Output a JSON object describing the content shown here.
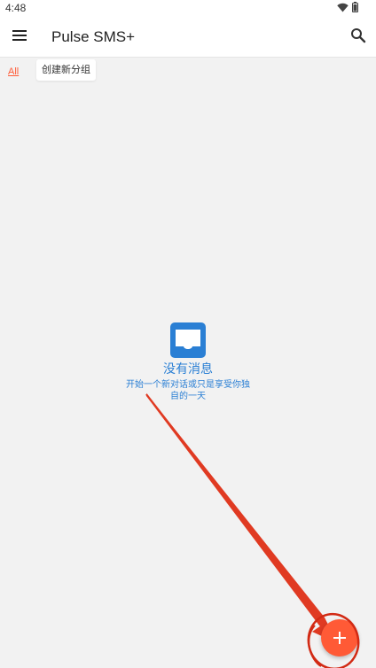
{
  "status_bar": {
    "time": "4:48",
    "icons": [
      "wifi-icon",
      "battery-icon"
    ]
  },
  "app_bar": {
    "title": "Pulse SMS+",
    "left_icon": "menu-icon",
    "right_icon": "search-icon"
  },
  "filters": {
    "all_label": "All",
    "new_group_label": "创建新分组"
  },
  "empty_state": {
    "icon": "inbox-icon",
    "title": "没有消息",
    "subtitle": "开始一个新对话或只是享受你独自的一天"
  },
  "fab": {
    "icon": "plus-icon",
    "label": "+"
  },
  "colors": {
    "accent": "#ff5a36",
    "primary": "#2a7fd4",
    "background": "#f2f2f2",
    "annotation": "#e03a22"
  }
}
